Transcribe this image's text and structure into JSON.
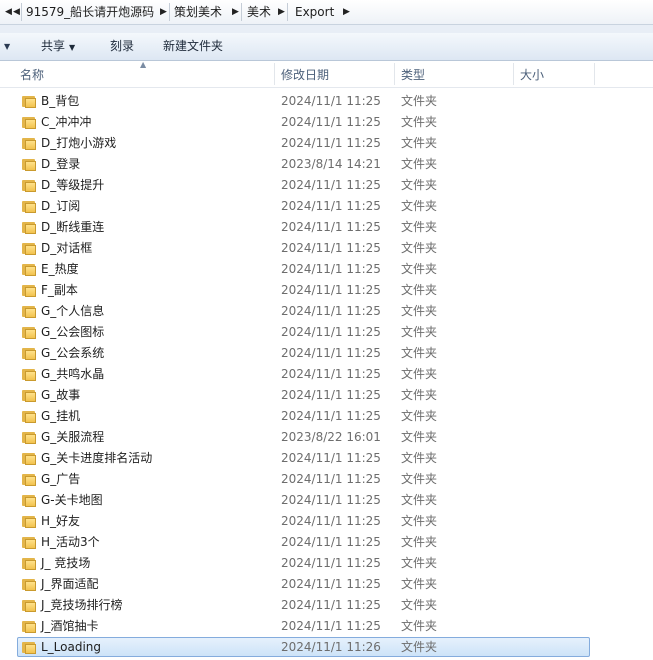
{
  "breadcrumb": {
    "items": [
      "91579_船长请开炮源码",
      "策划美术",
      "美术",
      "Export"
    ]
  },
  "toolbar": {
    "share": "共享",
    "burn": "刻录",
    "new_folder": "新建文件夹"
  },
  "columns": {
    "name": "名称",
    "date": "修改日期",
    "type": "类型",
    "size": "大小"
  },
  "files": [
    {
      "name": "B_背包",
      "date": "2024/11/1 11:25",
      "type": "文件夹"
    },
    {
      "name": "C_冲冲冲",
      "date": "2024/11/1 11:25",
      "type": "文件夹"
    },
    {
      "name": "D_打炮小游戏",
      "date": "2024/11/1 11:25",
      "type": "文件夹"
    },
    {
      "name": "D_登录",
      "date": "2023/8/14 14:21",
      "type": "文件夹"
    },
    {
      "name": "D_等级提升",
      "date": "2024/11/1 11:25",
      "type": "文件夹"
    },
    {
      "name": "D_订阅",
      "date": "2024/11/1 11:25",
      "type": "文件夹"
    },
    {
      "name": "D_断线重连",
      "date": "2024/11/1 11:25",
      "type": "文件夹"
    },
    {
      "name": "D_对话框",
      "date": "2024/11/1 11:25",
      "type": "文件夹"
    },
    {
      "name": "E_热度",
      "date": "2024/11/1 11:25",
      "type": "文件夹"
    },
    {
      "name": "F_副本",
      "date": "2024/11/1 11:25",
      "type": "文件夹"
    },
    {
      "name": "G_个人信息",
      "date": "2024/11/1 11:25",
      "type": "文件夹"
    },
    {
      "name": "G_公会图标",
      "date": "2024/11/1 11:25",
      "type": "文件夹"
    },
    {
      "name": "G_公会系统",
      "date": "2024/11/1 11:25",
      "type": "文件夹"
    },
    {
      "name": "G_共鸣水晶",
      "date": "2024/11/1 11:25",
      "type": "文件夹"
    },
    {
      "name": "G_故事",
      "date": "2024/11/1 11:25",
      "type": "文件夹"
    },
    {
      "name": "G_挂机",
      "date": "2024/11/1 11:25",
      "type": "文件夹"
    },
    {
      "name": "G_关服流程",
      "date": "2023/8/22 16:01",
      "type": "文件夹"
    },
    {
      "name": "G_关卡进度排名活动",
      "date": "2024/11/1 11:25",
      "type": "文件夹"
    },
    {
      "name": "G_广告",
      "date": "2024/11/1 11:25",
      "type": "文件夹"
    },
    {
      "name": "G-关卡地图",
      "date": "2024/11/1 11:25",
      "type": "文件夹"
    },
    {
      "name": "H_好友",
      "date": "2024/11/1 11:25",
      "type": "文件夹"
    },
    {
      "name": "H_活动3个",
      "date": "2024/11/1 11:25",
      "type": "文件夹"
    },
    {
      "name": "J_ 竞技场",
      "date": "2024/11/1 11:25",
      "type": "文件夹"
    },
    {
      "name": "J_界面适配",
      "date": "2024/11/1 11:25",
      "type": "文件夹"
    },
    {
      "name": "J_竞技场排行榜",
      "date": "2024/11/1 11:25",
      "type": "文件夹"
    },
    {
      "name": "J_酒馆抽卡",
      "date": "2024/11/1 11:25",
      "type": "文件夹"
    },
    {
      "name": "L_Loading",
      "date": "2024/11/1 11:26",
      "type": "文件夹",
      "selected": true
    }
  ]
}
